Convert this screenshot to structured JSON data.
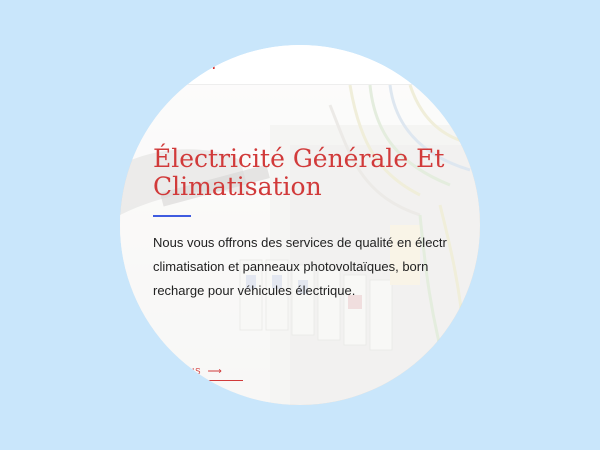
{
  "header": {
    "logo_text": "n"
  },
  "hero": {
    "title_line1": "Électricité Générale Et",
    "title_line2": "Climatisation",
    "desc_line1": "Nous vous offrons des services de qualité en électr",
    "desc_line2": "climatisation et panneaux photovoltaïques, born",
    "desc_line3": "recharge pour véhicules électrique.",
    "cta_label": "TEZ NOUS",
    "cta_icon": "arrow-right-icon"
  },
  "colors": {
    "background": "#c9e6fb",
    "accent_red": "#d13a3a",
    "accent_blue": "#3f5be0"
  }
}
